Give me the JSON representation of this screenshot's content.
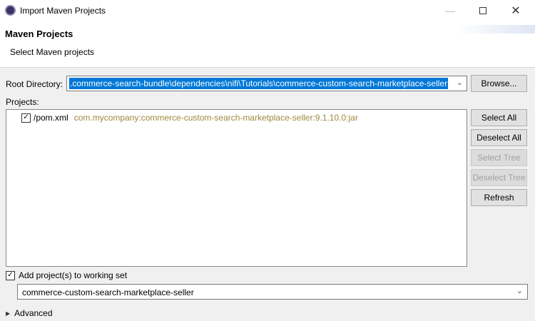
{
  "window": {
    "title": "Import Maven Projects"
  },
  "header": {
    "title": "Maven Projects",
    "subtitle": "Select Maven projects"
  },
  "root": {
    "label": "Root Directory:",
    "value": ".commerce-search-bundle\\dependencies\\nifi\\Tutorials\\commerce-custom-search-marketplace-seller",
    "browse": "Browse..."
  },
  "projects": {
    "label": "Projects:",
    "items": [
      {
        "name": "/pom.xml",
        "coords": "com.mycompany:commerce-custom-search-marketplace-seller:9.1.10.0:jar",
        "checked": true
      }
    ]
  },
  "buttons": {
    "select_all": "Select All",
    "deselect_all": "Deselect All",
    "select_tree": "Select Tree",
    "deselect_tree": "Deselect Tree",
    "refresh": "Refresh"
  },
  "working_set": {
    "label": "Add project(s) to working set",
    "checked": true,
    "value": "commerce-custom-search-marketplace-seller"
  },
  "advanced": {
    "label": "Advanced"
  },
  "colors": {
    "selection": "#0078d7",
    "coords": "#a0883c"
  }
}
